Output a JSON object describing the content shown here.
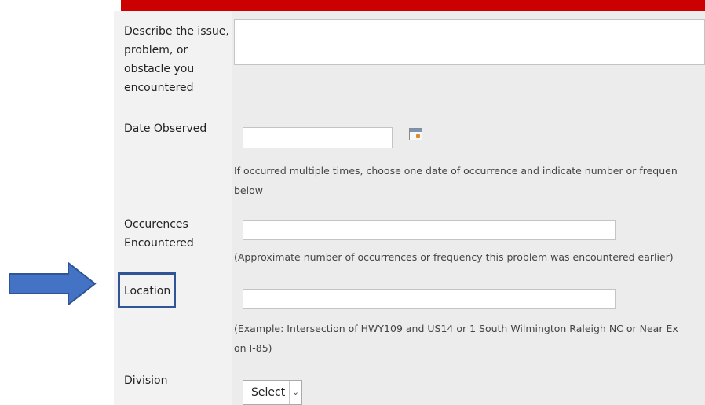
{
  "form": {
    "issue": {
      "label": "Describe the issue,\nproblem, or\nobstacle you\nencountered",
      "value": ""
    },
    "date_observed": {
      "label": "Date Observed",
      "value": "",
      "hint_line1": "If occurred multiple times, choose one date of occurrence and indicate number or frequen",
      "hint_line2": "below"
    },
    "occurrences": {
      "label": "Occurences\nEncountered",
      "value": "",
      "hint": "(Approximate number of occurrences or frequency this problem was encountered earlier)"
    },
    "location": {
      "label": "Location",
      "value": "",
      "hint_line1": "(Example: Intersection of HWY109 and US14 or 1 South Wilmington Raleigh NC or Near Ex",
      "hint_line2": "on I-85)"
    },
    "division": {
      "label": "Division",
      "selected": "Select"
    }
  },
  "colors": {
    "header_bar": "#cc0000",
    "highlight": "#2f5597",
    "arrow": "#4472c4"
  },
  "icons": {
    "calendar": "calendar-icon",
    "dropdown": "chevron-down-icon",
    "annotation": "right-arrow-icon"
  }
}
